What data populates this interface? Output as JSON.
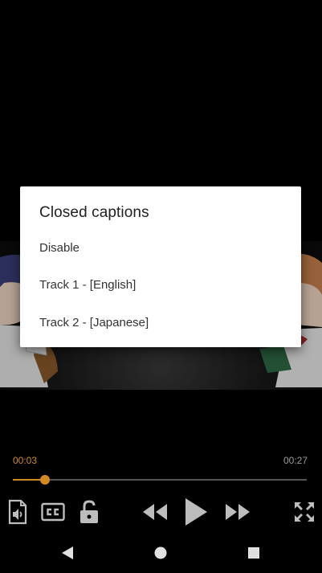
{
  "dialog": {
    "title": "Closed captions",
    "options": [
      {
        "label": "Disable"
      },
      {
        "label": "Track 1 - [English]"
      },
      {
        "label": "Track 2 - [Japanese]"
      }
    ]
  },
  "player": {
    "current_time": "00:03",
    "duration": "00:27",
    "progress": 0.11,
    "accent_color": "#d28a1e"
  },
  "controls": [
    {
      "name": "audio-file-icon"
    },
    {
      "name": "closed-captions-icon"
    },
    {
      "name": "unlock-icon"
    },
    {
      "name": "rewind-icon"
    },
    {
      "name": "play-icon"
    },
    {
      "name": "fast-forward-icon"
    },
    {
      "name": "fullscreen-icon"
    }
  ],
  "navigation": [
    "back-icon",
    "home-icon",
    "recents-icon"
  ]
}
